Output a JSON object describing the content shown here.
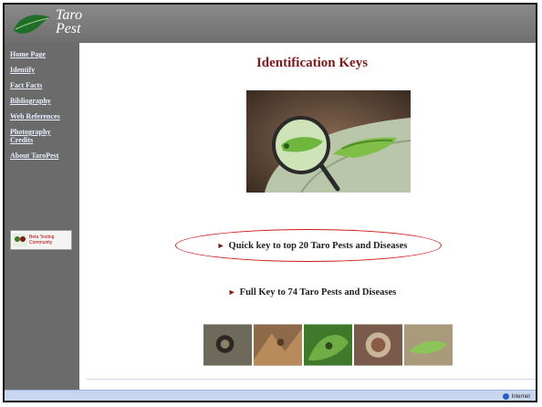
{
  "logo": {
    "line1": "Taro",
    "line2": "Pest"
  },
  "sidebar": {
    "items": [
      {
        "label": "Home Page"
      },
      {
        "label": "Identify"
      },
      {
        "label": "Fact Facts"
      },
      {
        "label": "Bibliography"
      },
      {
        "label": "Web References"
      },
      {
        "label": "Photography Credits"
      },
      {
        "label": "About TaroPest"
      }
    ],
    "badge": {
      "line1": "Beta Testing",
      "line2": "Community"
    }
  },
  "main": {
    "title": "Identification Keys",
    "quick_key": "Quick key to top 20 Taro Pests and Diseases",
    "full_key": "Full Key to 74 Taro Pests and Diseases",
    "arrow_glyph": "►"
  },
  "status": {
    "zone": "Internet"
  },
  "colors": {
    "header_gray": "#7d7d7d",
    "sidebar_gray": "#6b6b6b",
    "title_maroon": "#7a1a1a",
    "highlight_red": "#d01a1a",
    "status_blue": "#c8d6ef"
  }
}
